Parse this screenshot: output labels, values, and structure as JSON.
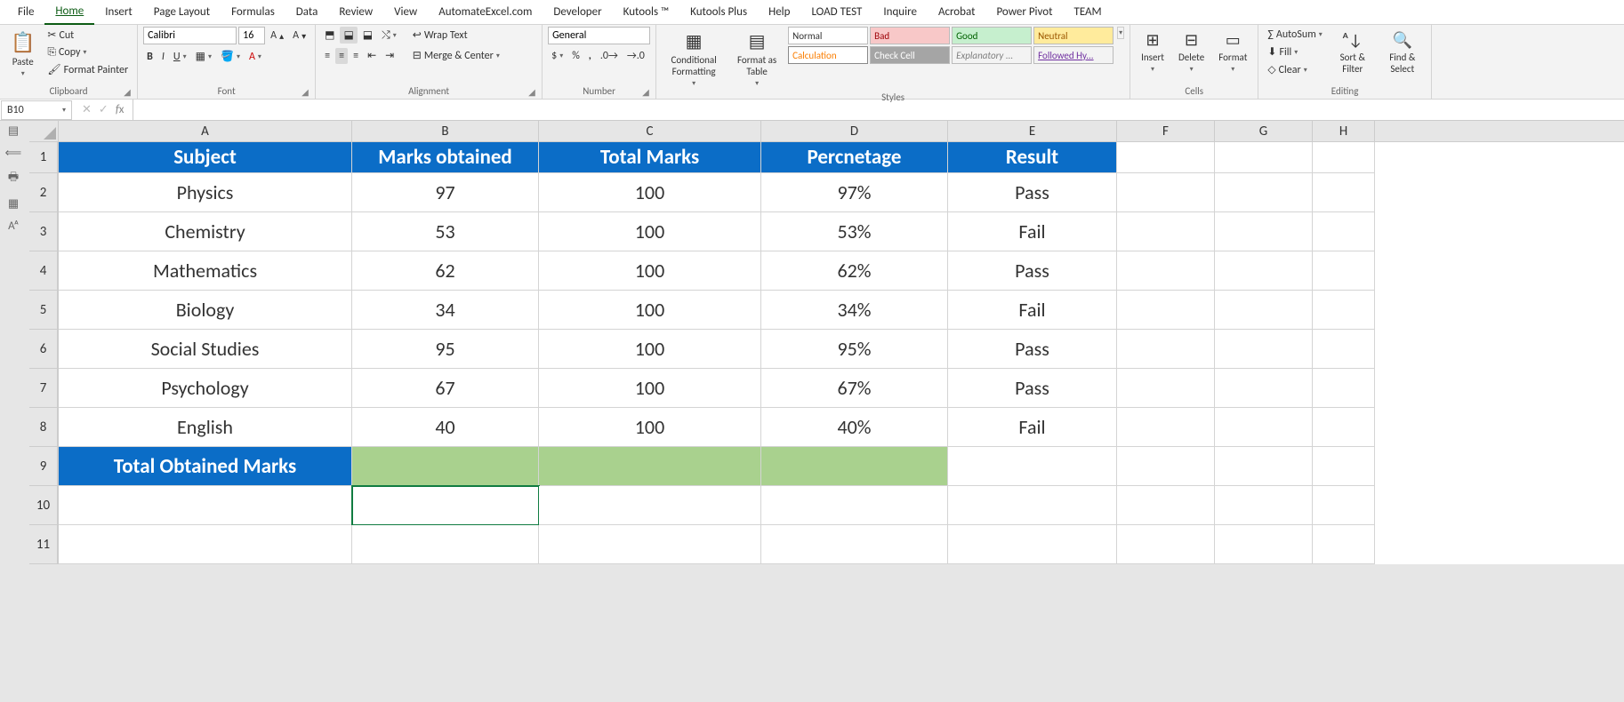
{
  "tabs": [
    "File",
    "Home",
    "Insert",
    "Page Layout",
    "Formulas",
    "Data",
    "Review",
    "View",
    "AutomateExcel.com",
    "Developer",
    "Kutools ™",
    "Kutools Plus",
    "Help",
    "LOAD TEST",
    "Inquire",
    "Acrobat",
    "Power Pivot",
    "TEAM"
  ],
  "activeTab": "Home",
  "clipboard": {
    "paste": "Paste",
    "cut": "Cut",
    "copy": "Copy",
    "painter": "Format Painter",
    "group": "Clipboard"
  },
  "font": {
    "name": "Calibri",
    "size": "16",
    "group": "Font"
  },
  "alignment": {
    "wrap": "Wrap Text",
    "merge": "Merge & Center",
    "group": "Alignment"
  },
  "number": {
    "format": "General",
    "group": "Number"
  },
  "stylesGroup": {
    "cond": "Conditional Formatting",
    "table": "Format as Table",
    "group": "Styles",
    "cells": {
      "normal": "Normal",
      "bad": "Bad",
      "good": "Good",
      "neutral": "Neutral",
      "calc": "Calculation",
      "check": "Check Cell",
      "expl": "Explanatory ...",
      "link": "Followed Hy..."
    }
  },
  "cells": {
    "insert": "Insert",
    "delete": "Delete",
    "format": "Format",
    "group": "Cells"
  },
  "editing": {
    "sum": "AutoSum",
    "fill": "Fill",
    "clear": "Clear",
    "sort": "Sort & Filter",
    "find": "Find & Select",
    "group": "Editing"
  },
  "nameBox": "B10",
  "columns": [
    "A",
    "B",
    "C",
    "D",
    "E",
    "F",
    "G",
    "H"
  ],
  "rowNums": [
    "1",
    "2",
    "3",
    "4",
    "5",
    "6",
    "7",
    "8",
    "9",
    "10",
    "11"
  ],
  "headers": {
    "A": "Subject",
    "B": "Marks obtained",
    "C": "Total Marks",
    "D": "Percnetage",
    "E": "Result"
  },
  "data": [
    {
      "A": "Physics",
      "B": "97",
      "C": "100",
      "D": "97%",
      "E": "Pass"
    },
    {
      "A": "Chemistry",
      "B": "53",
      "C": "100",
      "D": "53%",
      "E": "Fail"
    },
    {
      "A": "Mathematics",
      "B": "62",
      "C": "100",
      "D": "62%",
      "E": "Pass"
    },
    {
      "A": "Biology",
      "B": "34",
      "C": "100",
      "D": "34%",
      "E": "Fail"
    },
    {
      "A": "Social Studies",
      "B": "95",
      "C": "100",
      "D": "95%",
      "E": "Pass"
    },
    {
      "A": "Psychology",
      "B": "67",
      "C": "100",
      "D": "67%",
      "E": "Pass"
    },
    {
      "A": "English",
      "B": "40",
      "C": "100",
      "D": "40%",
      "E": "Fail"
    }
  ],
  "totalLabel": "Total Obtained Marks"
}
